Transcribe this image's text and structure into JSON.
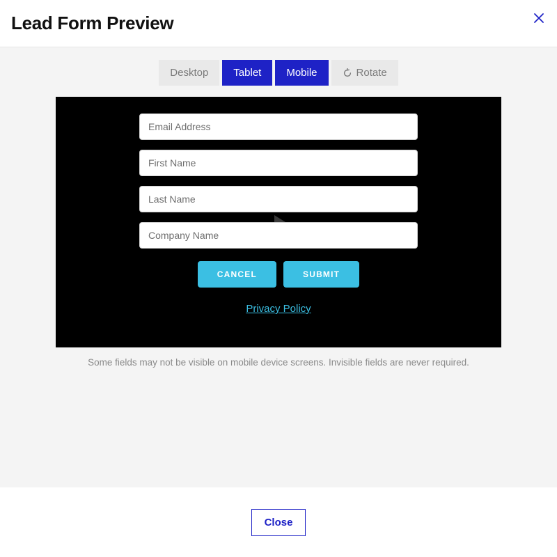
{
  "header": {
    "title": "Lead Form Preview"
  },
  "tabs": {
    "desktop": "Desktop",
    "tablet": "Tablet",
    "mobile": "Mobile",
    "rotate": "Rotate"
  },
  "form": {
    "fields": {
      "email_placeholder": "Email Address",
      "first_name_placeholder": "First Name",
      "last_name_placeholder": "Last Name",
      "company_placeholder": "Company Name"
    },
    "cancel_label": "CANCEL",
    "submit_label": "SUBMIT",
    "privacy_label": "Privacy Policy"
  },
  "hint": "Some fields may not be visible on mobile device screens. Invisible fields are never required.",
  "footer": {
    "close_label": "Close"
  },
  "colors": {
    "accent_blue": "#1e22c6",
    "button_cyan": "#3bbfe3"
  }
}
